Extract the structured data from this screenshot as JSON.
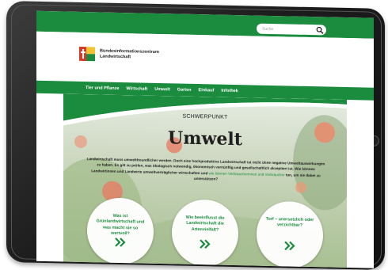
{
  "colors": {
    "brand_green": "#1b8b3e",
    "frame": "#1c1c1c"
  },
  "search": {
    "placeholder": "Suche",
    "icon": "search-icon"
  },
  "logo": {
    "icon": "logo-mark-icon",
    "line1": "Bundesinformationszentrum",
    "line2": "Landwirtschaft"
  },
  "nav": {
    "items": [
      {
        "label": "Tier und Pflanze"
      },
      {
        "label": "Wirtschaft"
      },
      {
        "label": "Umwelt"
      },
      {
        "label": "Garten"
      },
      {
        "label": "Einkauf"
      },
      {
        "label": "Infothek"
      }
    ]
  },
  "hero": {
    "eyebrow": "SCHWERPUNKT",
    "title": "Umwelt",
    "intro_part1": "Landwirtschaft muss umweltfreundlicher werden. Doch eine hochproduktive Landwirtschaft ist nicht ohne negative Umweltauswirkungen zu haben. Es gilt zu prüfen, was ökologisch notwendig, ökonomisch vernünftig und gesellschaftlich akzeptiert ist. Wie können Landwirtinnen und Landwirte umweltverträglicher wirtschaften und ",
    "intro_highlight": "wie können Verbraucherinnen und Verbraucher",
    "intro_part2": " tun, um sie dabei zu unterstützen?"
  },
  "cards": [
    {
      "title": "Was ist Grünlandwirtschaft und was macht sie so wertvoll?",
      "chevron": "double-chevron-icon"
    },
    {
      "title": "Wie beeinflusst die Landwirtschaft die Artenvielfalt?",
      "chevron": "double-chevron-icon"
    },
    {
      "title": "Torf – unersetzlich oder verzichtbar?",
      "chevron": "double-chevron-icon"
    }
  ]
}
